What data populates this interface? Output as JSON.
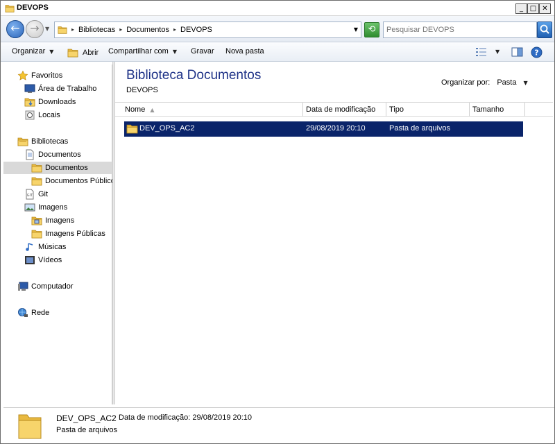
{
  "window": {
    "title": "DEVOPS"
  },
  "address": {
    "breadcrumbs": [
      "Bibliotecas",
      "Documentos",
      "DEVOPS"
    ]
  },
  "search": {
    "placeholder": "Pesquisar DEVOPS"
  },
  "toolbar": {
    "organize": "Organizar",
    "open": "Abrir",
    "share": "Compartilhar com",
    "burn": "Gravar",
    "new_folder": "Nova pasta"
  },
  "nav": {
    "favorites": "Favoritos",
    "desktop": "Área de Trabalho",
    "downloads": "Downloads",
    "recent": "Locais",
    "libraries": "Bibliotecas",
    "documents_lib": "Documentos",
    "documents": "Documentos",
    "public_documents": "Documentos Públicos",
    "git": "Git",
    "images_lib": "Imagens",
    "images": "Imagens",
    "public_images": "Imagens Públicas",
    "music": "Músicas",
    "videos": "Vídeos",
    "computer": "Computador",
    "network": "Rede"
  },
  "content": {
    "title": "Biblioteca Documentos",
    "subtitle": "DEVOPS",
    "arrange_label": "Organizar por:",
    "arrange_value": "Pasta",
    "columns": [
      "Nome",
      "Data de modificação",
      "Tipo",
      "Tamanho"
    ],
    "rows": [
      {
        "name": "DEV_OPS_AC2",
        "modified": "29/08/2019 20:10",
        "type": "Pasta de arquivos",
        "size": ""
      }
    ]
  },
  "details": {
    "name": "DEV_OPS_AC2",
    "modified_label": "Data de modificação:",
    "modified_value": "29/08/2019 20:10",
    "type": "Pasta de arquivos"
  },
  "colors": {
    "selection": "#0a246a",
    "title_blue": "#1e3287",
    "folder_yellow": "#f2c94c"
  }
}
